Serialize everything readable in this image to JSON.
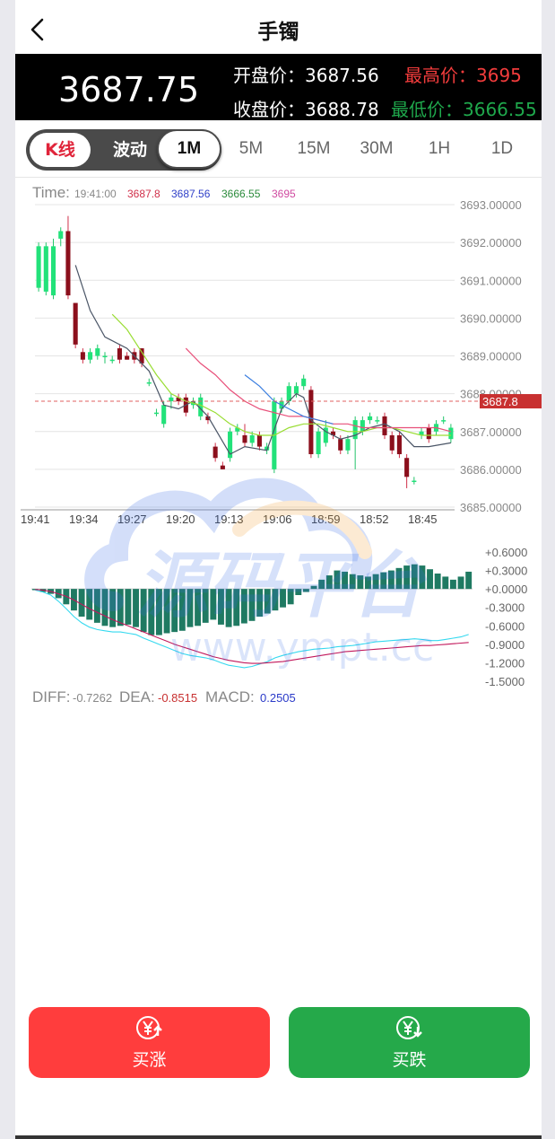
{
  "header": {
    "title": "手镯",
    "back_icon": "chevron-left-icon"
  },
  "quote": {
    "price": "3687.75",
    "open_label": "开盘价：",
    "open": "3687.56",
    "high_label": "最高价：",
    "high": "3695",
    "close_label": "收盘价：",
    "close": "3688.78",
    "low_label": "最低价：",
    "low": "3666.55",
    "colors": {
      "high": "#f23c3c",
      "low": "#1fa84c"
    }
  },
  "tabs": {
    "modes": [
      "K线",
      "波动"
    ],
    "active_mode": "K线",
    "timeframes": [
      "1M",
      "5M",
      "15M",
      "30M",
      "1H",
      "1D"
    ],
    "active_timeframe": "1M"
  },
  "chart_data": [
    {
      "type": "candlestick",
      "info": {
        "time_label": "Time:",
        "time": "19:41:00",
        "v1": "3687.8",
        "v2": "3687.56",
        "v3": "3666.55",
        "v4": "3695"
      },
      "y_ticks": [
        "3693.00000",
        "3692.00000",
        "3691.00000",
        "3690.00000",
        "3689.00000",
        "3688.00000",
        "3687.00000",
        "3686.00000",
        "3685.00000"
      ],
      "y_range": [
        3685,
        3693
      ],
      "x_ticks": [
        "19:41",
        "19:34",
        "19:27",
        "19:20",
        "19:13",
        "19:06",
        "18:59",
        "18:52",
        "18:45"
      ],
      "current_price_label": "3687.8",
      "current_price": 3687.8,
      "up_color": "#22e27a",
      "down_color": "#8b0f1c",
      "candles": [
        {
          "o": 3690.8,
          "c": 3691.9,
          "h": 3692.0,
          "l": 3690.7
        },
        {
          "o": 3690.7,
          "c": 3691.9,
          "h": 3692.0,
          "l": 3690.6
        },
        {
          "o": 3690.6,
          "c": 3691.9,
          "h": 3692.1,
          "l": 3690.5
        },
        {
          "o": 3692.1,
          "c": 3692.3,
          "h": 3692.4,
          "l": 3691.9
        },
        {
          "o": 3692.3,
          "c": 3690.6,
          "h": 3692.7,
          "l": 3690.5
        },
        {
          "o": 3690.4,
          "c": 3689.3,
          "h": 3690.4,
          "l": 3689.2
        },
        {
          "o": 3689.1,
          "c": 3688.9,
          "h": 3689.2,
          "l": 3688.8
        },
        {
          "o": 3688.9,
          "c": 3689.1,
          "h": 3689.2,
          "l": 3688.8
        },
        {
          "o": 3689.0,
          "c": 3689.2,
          "h": 3689.3,
          "l": 3688.9
        },
        {
          "o": 3689.0,
          "c": 3689.0,
          "h": 3689.1,
          "l": 3688.8
        },
        {
          "o": 3688.9,
          "c": 3688.9,
          "h": 3689.0,
          "l": 3688.8
        },
        {
          "o": 3689.2,
          "c": 3688.9,
          "h": 3689.3,
          "l": 3688.8
        },
        {
          "o": 3689.0,
          "c": 3688.9,
          "h": 3689.1,
          "l": 3688.9
        },
        {
          "o": 3689.1,
          "c": 3688.9,
          "h": 3689.2,
          "l": 3688.8
        },
        {
          "o": 3689.2,
          "c": 3688.8,
          "h": 3689.2,
          "l": 3688.7
        },
        {
          "o": 3688.3,
          "c": 3688.3,
          "h": 3688.4,
          "l": 3688.2
        },
        {
          "o": 3687.5,
          "c": 3687.5,
          "h": 3687.6,
          "l": 3687.4
        },
        {
          "o": 3687.2,
          "c": 3687.7,
          "h": 3687.8,
          "l": 3687.1
        },
        {
          "o": 3687.8,
          "c": 3687.9,
          "h": 3688.0,
          "l": 3687.6
        },
        {
          "o": 3687.9,
          "c": 3687.8,
          "h": 3688.0,
          "l": 3687.7
        },
        {
          "o": 3687.9,
          "c": 3687.5,
          "h": 3688.0,
          "l": 3687.4
        },
        {
          "o": 3687.7,
          "c": 3687.8,
          "h": 3687.9,
          "l": 3687.6
        },
        {
          "o": 3687.4,
          "c": 3687.9,
          "h": 3688.0,
          "l": 3687.3
        },
        {
          "o": 3687.4,
          "c": 3687.3,
          "h": 3687.5,
          "l": 3687.2
        },
        {
          "o": 3686.6,
          "c": 3686.3,
          "h": 3686.7,
          "l": 3686.2
        },
        {
          "o": 3686.1,
          "c": 3686.0,
          "h": 3686.2,
          "l": 3686.0
        },
        {
          "o": 3686.3,
          "c": 3687.0,
          "h": 3687.1,
          "l": 3686.2
        },
        {
          "o": 3687.0,
          "c": 3687.1,
          "h": 3687.2,
          "l": 3686.9
        },
        {
          "o": 3686.9,
          "c": 3686.7,
          "h": 3687.2,
          "l": 3686.6
        },
        {
          "o": 3686.7,
          "c": 3686.9,
          "h": 3687.0,
          "l": 3686.6
        },
        {
          "o": 3686.9,
          "c": 3686.6,
          "h": 3687.0,
          "l": 3686.5
        },
        {
          "o": 3686.5,
          "c": 3686.6,
          "h": 3686.7,
          "l": 3686.4
        },
        {
          "o": 3686.0,
          "c": 3687.8,
          "h": 3687.9,
          "l": 3685.9
        },
        {
          "o": 3687.6,
          "c": 3687.8,
          "h": 3687.9,
          "l": 3687.5
        },
        {
          "o": 3687.8,
          "c": 3688.2,
          "h": 3688.3,
          "l": 3687.7
        },
        {
          "o": 3688.0,
          "c": 3688.2,
          "h": 3688.3,
          "l": 3687.9
        },
        {
          "o": 3688.2,
          "c": 3688.4,
          "h": 3688.5,
          "l": 3688.1
        },
        {
          "o": 3688.1,
          "c": 3686.4,
          "h": 3688.2,
          "l": 3686.3
        },
        {
          "o": 3686.4,
          "c": 3687.0,
          "h": 3687.1,
          "l": 3686.3
        },
        {
          "o": 3686.7,
          "c": 3687.1,
          "h": 3687.3,
          "l": 3686.6
        },
        {
          "o": 3687.0,
          "c": 3686.9,
          "h": 3687.1,
          "l": 3686.8
        },
        {
          "o": 3686.8,
          "c": 3686.5,
          "h": 3686.9,
          "l": 3686.4
        },
        {
          "o": 3686.5,
          "c": 3686.8,
          "h": 3686.9,
          "l": 3686.4
        },
        {
          "o": 3686.8,
          "c": 3687.3,
          "h": 3687.4,
          "l": 3686.0
        },
        {
          "o": 3687.0,
          "c": 3687.3,
          "h": 3687.4,
          "l": 3686.9
        },
        {
          "o": 3687.3,
          "c": 3687.4,
          "h": 3687.5,
          "l": 3687.2
        },
        {
          "o": 3687.3,
          "c": 3687.3,
          "h": 3687.4,
          "l": 3687.2
        },
        {
          "o": 3687.4,
          "c": 3686.9,
          "h": 3687.5,
          "l": 3686.8
        },
        {
          "o": 3686.9,
          "c": 3686.5,
          "h": 3687.0,
          "l": 3686.4
        },
        {
          "o": 3686.9,
          "c": 3686.4,
          "h": 3687.0,
          "l": 3686.3
        },
        {
          "o": 3686.3,
          "c": 3685.8,
          "h": 3686.4,
          "l": 3685.5
        },
        {
          "o": 3685.7,
          "c": 3685.7,
          "h": 3685.8,
          "l": 3685.6
        },
        {
          "o": 3686.9,
          "c": 3687.0,
          "h": 3687.1,
          "l": 3686.8
        },
        {
          "o": 3687.1,
          "c": 3686.8,
          "h": 3687.2,
          "l": 3686.7
        },
        {
          "o": 3687.0,
          "c": 3687.2,
          "h": 3687.3,
          "l": 3686.9
        },
        {
          "o": 3687.3,
          "c": 3687.3,
          "h": 3687.4,
          "l": 3687.2
        },
        {
          "o": 3686.8,
          "c": 3687.1,
          "h": 3687.2,
          "l": 3686.7
        }
      ],
      "ma_lines": [
        {
          "color": "#4a5566",
          "points": [
            [
              5,
              3691.4
            ],
            [
              7,
              3690.2
            ],
            [
              9,
              3689.5
            ],
            [
              12,
              3689.2
            ],
            [
              15,
              3688.6
            ],
            [
              17,
              3687.7
            ],
            [
              19,
              3687.6
            ],
            [
              21,
              3687.8
            ],
            [
              23,
              3687.4
            ],
            [
              26,
              3686.4
            ],
            [
              28,
              3686.6
            ],
            [
              31,
              3686.5
            ],
            [
              33,
              3687.6
            ],
            [
              35,
              3688.0
            ],
            [
              36,
              3687.9
            ],
            [
              37,
              3687.3
            ],
            [
              39,
              3687.0
            ],
            [
              41,
              3686.8
            ],
            [
              43,
              3686.9
            ],
            [
              45,
              3687.1
            ],
            [
              47,
              3687.2
            ],
            [
              49,
              3687.0
            ],
            [
              51,
              3686.6
            ],
            [
              53,
              3686.6
            ],
            [
              56,
              3686.7
            ]
          ]
        },
        {
          "color": "#99dd33",
          "points": [
            [
              10,
              3690.1
            ],
            [
              12,
              3689.7
            ],
            [
              14,
              3689.1
            ],
            [
              16,
              3688.5
            ],
            [
              18,
              3688.0
            ],
            [
              20,
              3687.8
            ],
            [
              22,
              3687.7
            ],
            [
              24,
              3687.5
            ],
            [
              26,
              3687.2
            ],
            [
              28,
              3687.0
            ],
            [
              30,
              3686.9
            ],
            [
              32,
              3686.9
            ],
            [
              34,
              3687.1
            ],
            [
              36,
              3687.2
            ],
            [
              38,
              3687.2
            ],
            [
              40,
              3687.1
            ],
            [
              42,
              3687.0
            ],
            [
              44,
              3687.0
            ],
            [
              46,
              3687.1
            ],
            [
              48,
              3687.1
            ],
            [
              50,
              3687.0
            ],
            [
              52,
              3686.9
            ],
            [
              54,
              3686.9
            ],
            [
              56,
              3686.9
            ]
          ]
        },
        {
          "color": "#e8507a",
          "points": [
            [
              20,
              3689.2
            ],
            [
              22,
              3688.8
            ],
            [
              24,
              3688.5
            ],
            [
              26,
              3688.1
            ],
            [
              28,
              3687.8
            ],
            [
              30,
              3687.6
            ],
            [
              32,
              3687.5
            ],
            [
              34,
              3687.4
            ],
            [
              36,
              3687.4
            ],
            [
              38,
              3687.3
            ],
            [
              40,
              3687.2
            ],
            [
              42,
              3687.2
            ],
            [
              44,
              3687.1
            ],
            [
              46,
              3687.1
            ],
            [
              48,
              3687.1
            ],
            [
              50,
              3687.1
            ],
            [
              52,
              3687.1
            ],
            [
              54,
              3687.1
            ],
            [
              56,
              3687.0
            ]
          ]
        },
        {
          "color": "#3a7ee0",
          "points": [
            [
              28,
              3688.5
            ],
            [
              30,
              3688.2
            ],
            [
              32,
              3687.8
            ],
            [
              34,
              3687.6
            ],
            [
              36,
              3687.4
            ],
            [
              38,
              3687.3
            ],
            [
              40,
              3687.2
            ]
          ]
        }
      ]
    },
    {
      "type": "macd",
      "y_ticks": [
        "+0.6000",
        "+0.3000",
        "+0.0000",
        "-0.3000",
        "-0.6000",
        "-0.9000",
        "-1.2000",
        "-1.5000"
      ],
      "y_range": [
        -1.5,
        0.6
      ],
      "bar_color": "#1f7a62",
      "hist": [
        -0.02,
        -0.05,
        -0.08,
        -0.15,
        -0.25,
        -0.35,
        -0.45,
        -0.5,
        -0.55,
        -0.6,
        -0.62,
        -0.6,
        -0.58,
        -0.62,
        -0.7,
        -0.75,
        -0.75,
        -0.72,
        -0.7,
        -0.68,
        -0.62,
        -0.6,
        -0.55,
        -0.5,
        -0.58,
        -0.62,
        -0.6,
        -0.56,
        -0.52,
        -0.45,
        -0.4,
        -0.35,
        -0.3,
        -0.25,
        -0.1,
        -0.05,
        0.05,
        0.15,
        0.22,
        0.3,
        0.28,
        0.24,
        0.22,
        0.2,
        0.24,
        0.27,
        0.3,
        0.34,
        0.38,
        0.4,
        0.38,
        0.32,
        0.25,
        0.2,
        0.15,
        0.2,
        0.28
      ],
      "diff_line": {
        "color": "#35d9ef",
        "values": [
          -0.02,
          -0.05,
          -0.1,
          -0.2,
          -0.32,
          -0.45,
          -0.55,
          -0.62,
          -0.66,
          -0.68,
          -0.7,
          -0.7,
          -0.72,
          -0.74,
          -0.8,
          -0.85,
          -0.9,
          -0.95,
          -1.0,
          -1.05,
          -1.08,
          -1.1,
          -1.12,
          -1.15,
          -1.2,
          -1.24,
          -1.26,
          -1.28,
          -1.26,
          -1.22,
          -1.18,
          -1.12,
          -1.08,
          -1.05,
          -1.02,
          -1.0,
          -0.98,
          -0.97,
          -0.96,
          -0.94,
          -0.93,
          -0.92,
          -0.9,
          -0.88,
          -0.86,
          -0.85,
          -0.84,
          -0.83,
          -0.82,
          -0.81,
          -0.82,
          -0.84,
          -0.84,
          -0.82,
          -0.8,
          -0.78,
          -0.74
        ]
      },
      "dea_line": {
        "color": "#c2185b",
        "values": [
          -0.01,
          -0.02,
          -0.04,
          -0.08,
          -0.12,
          -0.18,
          -0.25,
          -0.32,
          -0.38,
          -0.44,
          -0.5,
          -0.55,
          -0.6,
          -0.65,
          -0.7,
          -0.75,
          -0.8,
          -0.85,
          -0.9,
          -0.94,
          -0.98,
          -1.02,
          -1.06,
          -1.1,
          -1.13,
          -1.16,
          -1.18,
          -1.2,
          -1.21,
          -1.21,
          -1.2,
          -1.19,
          -1.18,
          -1.16,
          -1.14,
          -1.12,
          -1.1,
          -1.08,
          -1.06,
          -1.04,
          -1.02,
          -1.01,
          -1.0,
          -0.99,
          -0.98,
          -0.97,
          -0.96,
          -0.95,
          -0.94,
          -0.93,
          -0.92,
          -0.92,
          -0.91,
          -0.9,
          -0.89,
          -0.88,
          -0.87
        ]
      },
      "legend": {
        "diff_label": "DIFF:",
        "diff": "-0.7262",
        "dea_label": "DEA:",
        "dea": "-0.8515",
        "macd_label": "MACD:",
        "macd": "0.2505"
      }
    }
  ],
  "watermark": {
    "title": "源码平台",
    "url": "www.ympt.cc"
  },
  "actions": {
    "buy_up": {
      "label": "买涨",
      "color": "#ff3d3d",
      "icon": "yen-up-icon"
    },
    "buy_down": {
      "label": "买跌",
      "color": "#25a94a",
      "icon": "yen-down-icon"
    }
  }
}
